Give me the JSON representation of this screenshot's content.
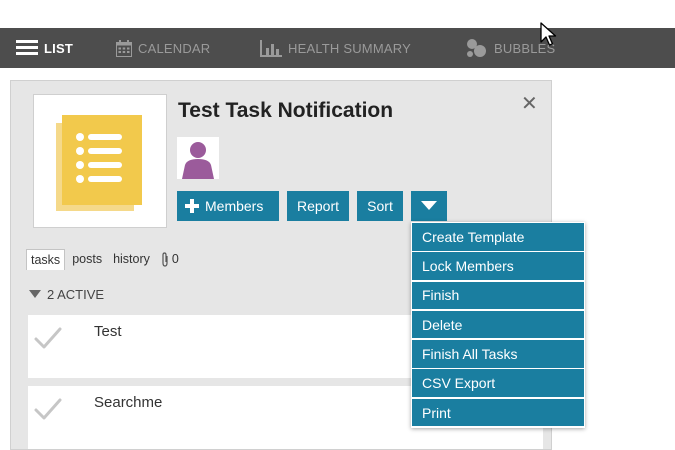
{
  "nav": {
    "items": [
      {
        "label": "LIST",
        "icon": "list-icon",
        "active": true
      },
      {
        "label": "CALENDAR",
        "icon": "calendar-icon",
        "active": false
      },
      {
        "label": "HEALTH SUMMARY",
        "icon": "bar-chart-icon",
        "active": false
      },
      {
        "label": "BUBBLES",
        "icon": "bubbles-icon",
        "active": false
      }
    ]
  },
  "task": {
    "title": "Test Task Notification",
    "close_icon": "close-icon",
    "members_label": "Members",
    "report_label": "Report",
    "sort_label": "Sort"
  },
  "tabs": {
    "tasks": "tasks",
    "posts": "posts",
    "history": "history",
    "attachments_count": "0"
  },
  "section": {
    "label": "2 ACTIVE"
  },
  "tasks": [
    {
      "name": "Test"
    },
    {
      "name": "Searchme"
    }
  ],
  "menu": {
    "items": [
      "Create Template",
      "Lock Members",
      "Finish",
      "Delete",
      "Finish All Tasks",
      "CSV Export",
      "Print"
    ]
  },
  "colors": {
    "navbar": "#4d4d4d",
    "accent": "#1a7ea0",
    "panel": "#e6e6e6",
    "avatar": "#9b5b9b",
    "thumbnail": "#f2c94c"
  }
}
